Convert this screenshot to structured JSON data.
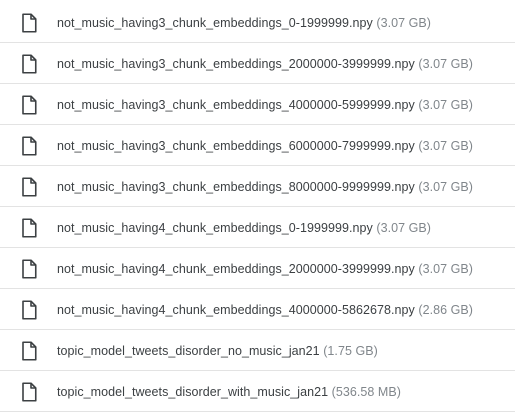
{
  "files": [
    {
      "name": "not_music_having3_chunk_embeddings_0-1999999.npy",
      "size": "(3.07 GB)",
      "icon": "file-icon"
    },
    {
      "name": "not_music_having3_chunk_embeddings_2000000-3999999.npy",
      "size": "(3.07 GB)",
      "icon": "file-icon"
    },
    {
      "name": "not_music_having3_chunk_embeddings_4000000-5999999.npy",
      "size": "(3.07 GB)",
      "icon": "file-icon"
    },
    {
      "name": "not_music_having3_chunk_embeddings_6000000-7999999.npy",
      "size": "(3.07 GB)",
      "icon": "file-icon"
    },
    {
      "name": "not_music_having3_chunk_embeddings_8000000-9999999.npy",
      "size": "(3.07 GB)",
      "icon": "file-icon"
    },
    {
      "name": "not_music_having4_chunk_embeddings_0-1999999.npy",
      "size": "(3.07 GB)",
      "icon": "file-icon"
    },
    {
      "name": "not_music_having4_chunk_embeddings_2000000-3999999.npy",
      "size": "(3.07 GB)",
      "icon": "file-icon"
    },
    {
      "name": "not_music_having4_chunk_embeddings_4000000-5862678.npy",
      "size": "(2.86 GB)",
      "icon": "file-icon"
    },
    {
      "name": "topic_model_tweets_disorder_no_music_jan21",
      "size": "(1.75 GB)",
      "icon": "file-icon"
    },
    {
      "name": "topic_model_tweets_disorder_with_music_jan21",
      "size": "(536.58 MB)",
      "icon": "file-icon"
    }
  ],
  "colors": {
    "name_text": "#3c4043",
    "size_text": "#80868b",
    "divider": "#e3e3e3",
    "icon": "#3c4043"
  }
}
